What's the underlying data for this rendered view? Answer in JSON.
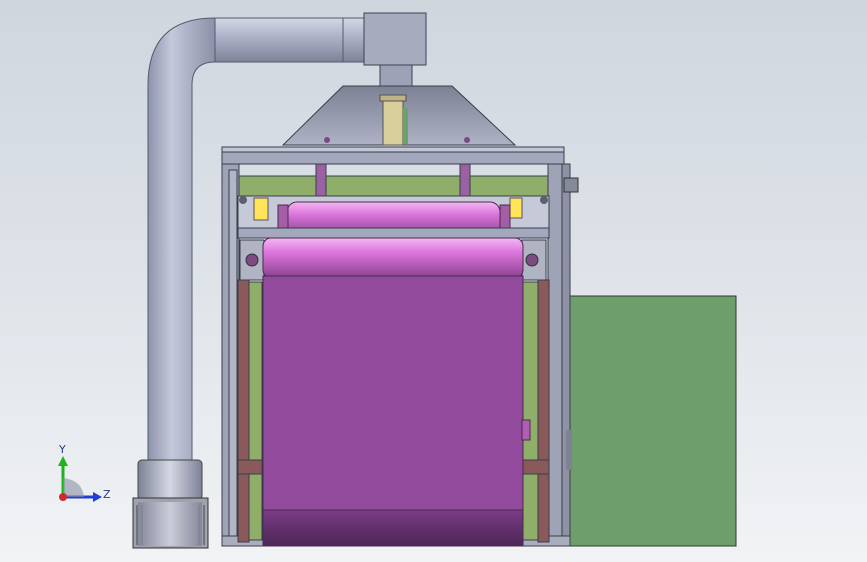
{
  "viewport": {
    "background_top": "#cfd6de",
    "background_bottom": "#f1f3f5"
  },
  "model": {
    "duct_color": "#a9aec5",
    "frame_color": "#9fa4b8",
    "frame_edge": "#3a3d4a",
    "roller_color": "#cc66cc",
    "belt_color": "#924a9c",
    "inner_panel_color": "#8fae6a",
    "control_cabinet_color": "#6e9e69",
    "rail_color": "#8a5a5a",
    "filter_color": "#d9cf9a"
  },
  "triad": {
    "y_label": "Y",
    "z_label": "Z",
    "y_axis_color": "#1db31d",
    "z_axis_color": "#1f3fd6",
    "origin_color": "#d22a2a"
  }
}
